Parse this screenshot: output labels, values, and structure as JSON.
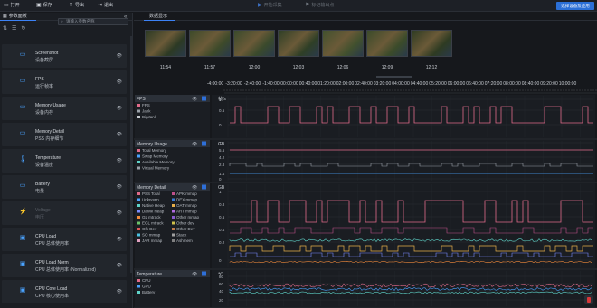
{
  "toolbar": {
    "open": "打开",
    "save": "保存",
    "export": "导出",
    "exit": "退出",
    "start_record": "开始采集",
    "mark": "标记输出点",
    "select_device": "选择设备及应用"
  },
  "left_panel": {
    "title": "参数面板",
    "search_placeholder": "请输入参数名称",
    "params": [
      {
        "name": "Screenshot",
        "sub": "设备截屏",
        "icon": "image-icon",
        "dim": false
      },
      {
        "name": "FPS",
        "sub": "运行帧率",
        "icon": "fps-icon",
        "dim": false
      },
      {
        "name": "Memory Usage",
        "sub": "设备内存",
        "icon": "memory-icon",
        "dim": false
      },
      {
        "name": "Memory Detail",
        "sub": "PSS 内存细节",
        "icon": "memory-detail-icon",
        "dim": false
      },
      {
        "name": "Temperature",
        "sub": "设备温度",
        "icon": "thermometer-icon",
        "dim": false
      },
      {
        "name": "Battery",
        "sub": "电量",
        "icon": "battery-icon",
        "dim": false
      },
      {
        "name": "Voltage",
        "sub": "电压",
        "icon": "voltage-icon",
        "dim": true
      },
      {
        "name": "CPU Load",
        "sub": "CPU 总体使用率",
        "icon": "cpu-icon",
        "dim": false
      },
      {
        "name": "CPU Load Norm",
        "sub": "CPU 总体使用率 (Normalized)",
        "icon": "cpu-icon",
        "dim": false
      },
      {
        "name": "CPU Core Load",
        "sub": "CPU 核心使用率",
        "icon": "cpu-icon",
        "dim": false
      }
    ]
  },
  "right_panel": {
    "title": "数据显示"
  },
  "screenshots": {
    "times": [
      "11:54",
      "11:57",
      "12:00",
      "12:03",
      "12:06",
      "12:09",
      "12:12"
    ]
  },
  "timeline": {
    "labels": [
      "-4:00:00",
      "-3:20:00",
      "-2:40:00",
      "-1:40:00",
      "00:00:00",
      "00:40:00",
      "01:20:00",
      "02:00:00",
      "02:40:00",
      "03:20:00",
      "04:00:00",
      "04:40:00",
      "05:20:00",
      "06:00:00",
      "06:40:00",
      "07:20:00",
      "08:00:00",
      "08:40:00",
      "09:20:00",
      "10:00:00",
      "10:40:00",
      "11:20:00",
      "12:00:00",
      "12:40:00",
      "13:20:00",
      "14:00:00",
      "14:40:00",
      "15:20:00",
      "16:00:00",
      "16:40:00",
      "17:20:00",
      "18:00:00",
      "18:40:00",
      "19:20:00",
      "20:00:00",
      "20:40:00",
      "21:20:00",
      "22:00:00"
    ]
  },
  "panels": {
    "fps": {
      "title": "FPS",
      "unit": "帧/s",
      "ticks": [
        "1",
        "0.5",
        "0"
      ],
      "legend": [
        {
          "label": "FPS",
          "color": "#e06b8a"
        },
        {
          "label": "Jank",
          "color": "#9aa0a8"
        },
        {
          "label": "BigJank",
          "color": "#c8ccd2"
        }
      ]
    },
    "memory_usage": {
      "title": "Memory Usage",
      "unit": "GB",
      "ticks": [
        "7",
        "5.6",
        "4.2",
        "2.8",
        "1.4",
        "0"
      ],
      "legend": [
        {
          "label": "Total Memory",
          "color": "#e06b8a"
        },
        {
          "label": "Swap Memory",
          "color": "#4aa3ff"
        },
        {
          "label": "Available Memory",
          "color": "#5fd3c8"
        },
        {
          "label": "Virtual Memory",
          "color": "#9aa0a8"
        }
      ]
    },
    "memory_detail": {
      "title": "Memory Detail",
      "unit": "GB",
      "ticks": [
        "1",
        "0.8",
        "0.6",
        "0.4",
        "0.2",
        "0"
      ],
      "legend": [
        {
          "label": "PSS Total",
          "color": "#e06b8a"
        },
        {
          "label": "APK mmap",
          "color": "#c0508a"
        },
        {
          "label": "Unknown",
          "color": "#4aa3ff"
        },
        {
          "label": "DEX mmap",
          "color": "#3a7bd5"
        },
        {
          "label": "Native Heap",
          "color": "#5fd3c8"
        },
        {
          "label": "OAT mmap",
          "color": "#e8b04a"
        },
        {
          "label": "Dalvik Heap",
          "color": "#7a8cff"
        },
        {
          "label": "ART mmap",
          "color": "#b06be0"
        },
        {
          "label": "GL mtrack",
          "color": "#f08a3c"
        },
        {
          "label": "Other mmap",
          "color": "#8a5ad0"
        },
        {
          "label": "EGL mtrack",
          "color": "#6ac26a"
        },
        {
          "label": "Other dev",
          "color": "#d0c04a"
        },
        {
          "label": "Gfx Dev",
          "color": "#e05a5a"
        },
        {
          "label": "Other Dev",
          "color": "#c07a4a"
        },
        {
          "label": "SO mmap",
          "color": "#4ac0e0"
        },
        {
          "label": "Stack",
          "color": "#a0a0a0"
        },
        {
          "label": "JAR mmap",
          "color": "#e0a0c0"
        },
        {
          "label": "Ashmem",
          "color": "#808080"
        }
      ]
    },
    "temperature": {
      "title": "Temperature",
      "unit": "℃",
      "ticks": [
        "80",
        "60",
        "40",
        "20"
      ],
      "legend": [
        {
          "label": "CPU",
          "color": "#e06b8a"
        },
        {
          "label": "GPU",
          "color": "#4aa3ff"
        },
        {
          "label": "Battery",
          "color": "#5fd3c8"
        }
      ]
    }
  }
}
